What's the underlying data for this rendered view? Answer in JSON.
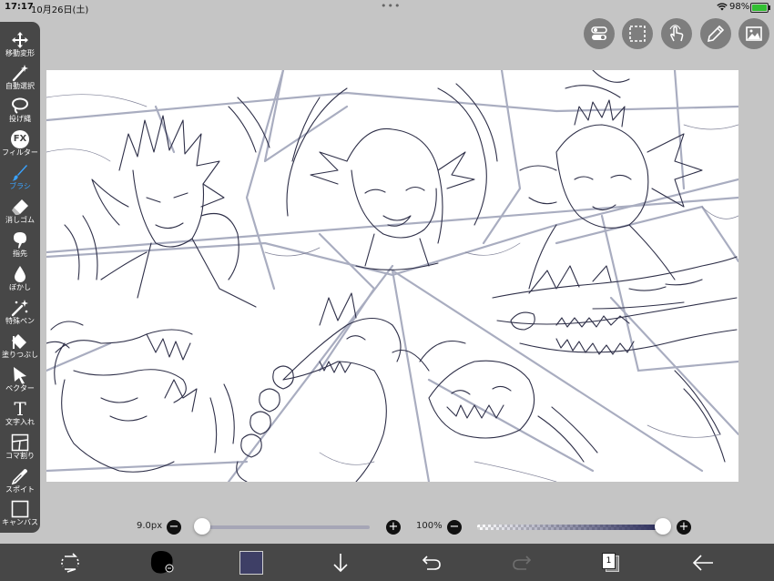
{
  "status_bar": {
    "time": "17:17",
    "date": "10月26日(土)",
    "battery": "98%",
    "battery_level": 0.98
  },
  "toolbar": {
    "tools": [
      {
        "label": "移動変形",
        "icon": "move-arrows-icon"
      },
      {
        "label": "自動選択",
        "icon": "magic-wand-icon"
      },
      {
        "label": "投げ縄",
        "icon": "lasso-icon"
      },
      {
        "label": "フィルター",
        "icon": "fx-icon",
        "icon_text": "FX"
      },
      {
        "label": "ブラシ",
        "icon": "brush-icon",
        "active": true
      },
      {
        "label": "消しゴム",
        "icon": "eraser-icon"
      },
      {
        "label": "指先",
        "icon": "smudge-icon"
      },
      {
        "label": "ぼかし",
        "icon": "blur-drop-icon"
      },
      {
        "label": "特殊ペン",
        "icon": "special-pen-icon"
      },
      {
        "label": "塗りつぶし",
        "icon": "fill-bucket-icon"
      },
      {
        "label": "ベクター",
        "icon": "vector-cursor-icon"
      },
      {
        "label": "文字入れ",
        "icon": "text-icon",
        "icon_text": "T"
      },
      {
        "label": "コマ割り",
        "icon": "frame-divider-icon"
      },
      {
        "label": "スポイト",
        "icon": "eyedropper-icon"
      },
      {
        "label": "キャンバス",
        "icon": "canvas-icon"
      }
    ]
  },
  "top_buttons": [
    {
      "icon": "toggle-icon"
    },
    {
      "icon": "selection-icon"
    },
    {
      "icon": "touch-gesture-icon"
    },
    {
      "icon": "pencil-icon"
    },
    {
      "icon": "gallery-icon"
    }
  ],
  "brush_size": {
    "value_label": "9.0px",
    "minus": "−",
    "plus": "+",
    "level": 0.03
  },
  "opacity": {
    "value_label": "100%",
    "minus": "−",
    "plus": "+",
    "level": 1.0
  },
  "bottom_bar": {
    "brush_color": "#3e3f66",
    "layer_count": "1",
    "icons": [
      "transform-rotate-icon",
      "brush-preview-icon",
      "color-swatch",
      "download-arrow-icon",
      "undo-icon",
      "redo-icon",
      "layers-icon",
      "back-arrow-icon"
    ]
  },
  "colors": {
    "toolbar_bg": "#474747",
    "active_tool": "#3aa3ff",
    "sketch_stroke": "#2e2f48",
    "guide_stroke": "#a9adc0"
  }
}
